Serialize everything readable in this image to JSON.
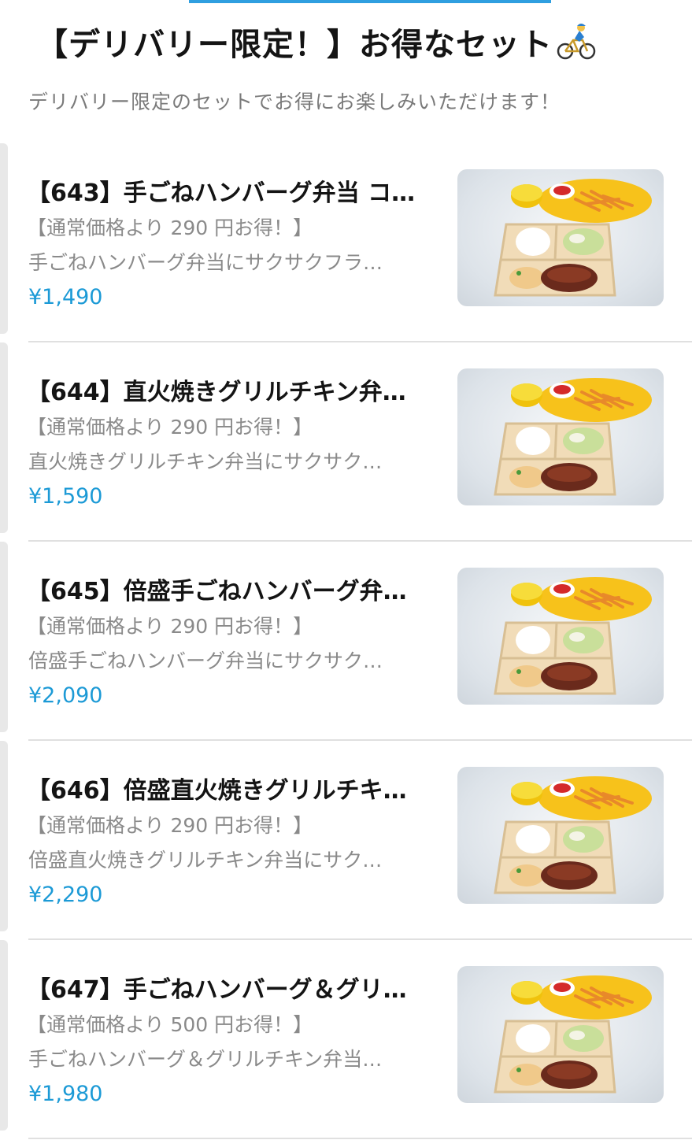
{
  "header": {
    "title": "【デリバリー限定！】お得なセット",
    "title_icon": "bicycle-rider-icon",
    "subtitle": "デリバリー限定のセットでお得にお楽しみいただけます！"
  },
  "colors": {
    "price": "#1c9ad6",
    "accent_bar": "#2f9fe0",
    "muted_text": "#8a8a8a"
  },
  "items": [
    {
      "title": "【643】手ごねハンバーグ弁当 コ…",
      "discount": "【通常価格より 290 円お得！】",
      "description": "手ごねハンバーグ弁当にサクサクフラ…",
      "price": "¥1,490",
      "image_icon": "hamburg-bento-photo"
    },
    {
      "title": "【644】直火焼きグリルチキン弁…",
      "discount": "【通常価格より 290 円お得！】",
      "description": "直火焼きグリルチキン弁当にサクサク…",
      "price": "¥1,590",
      "image_icon": "grilled-chicken-bento-photo"
    },
    {
      "title": "【645】倍盛手ごねハンバーグ弁…",
      "discount": "【通常価格より 290 円お得！】",
      "description": "倍盛手ごねハンバーグ弁当にサクサク…",
      "price": "¥2,090",
      "image_icon": "double-hamburg-bento-photo"
    },
    {
      "title": "【646】倍盛直火焼きグリルチキ…",
      "discount": "【通常価格より 290 円お得！】",
      "description": "倍盛直火焼きグリルチキン弁当にサク…",
      "price": "¥2,290",
      "image_icon": "double-chicken-bento-photo"
    },
    {
      "title": "【647】手ごねハンバーグ＆グリ…",
      "discount": "【通常価格より 500 円お得！】",
      "description": "手ごねハンバーグ＆グリルチキン弁当…",
      "price": "¥1,980",
      "image_icon": "hamburg-and-chicken-bento-photo"
    }
  ]
}
